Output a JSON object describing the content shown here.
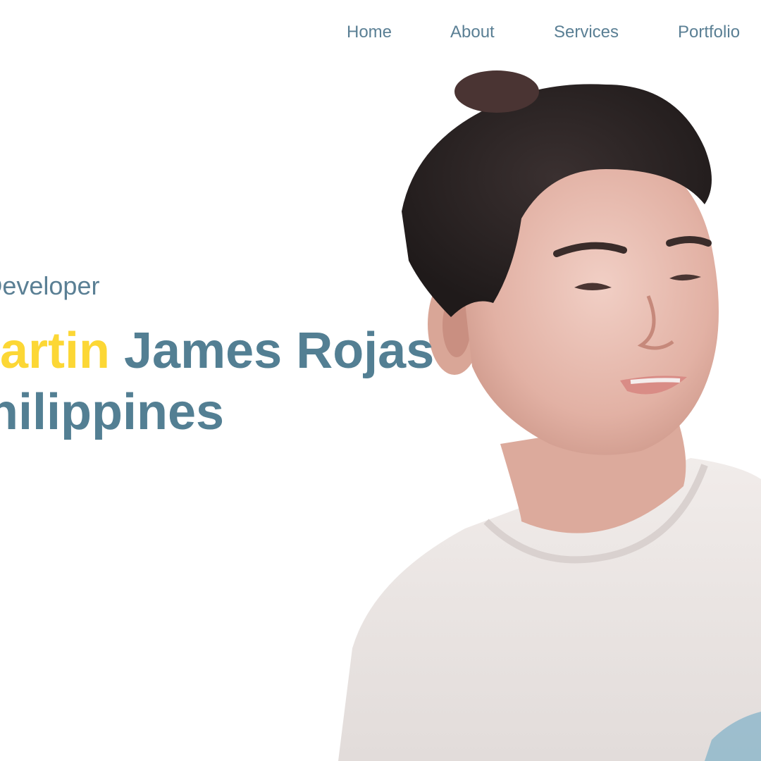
{
  "nav": {
    "items": [
      {
        "label": "Home"
      },
      {
        "label": "About"
      },
      {
        "label": "Services"
      },
      {
        "label": "Portfolio"
      }
    ]
  },
  "hero": {
    "role": "Web Developer",
    "name_first": "Martin",
    "name_rest": " James Rojas",
    "location": "Philippines"
  },
  "colors": {
    "accent_yellow": "#fcd735",
    "primary_blue": "#537f93",
    "background": "#ffffff"
  },
  "images": {
    "portrait": "person-portrait"
  }
}
